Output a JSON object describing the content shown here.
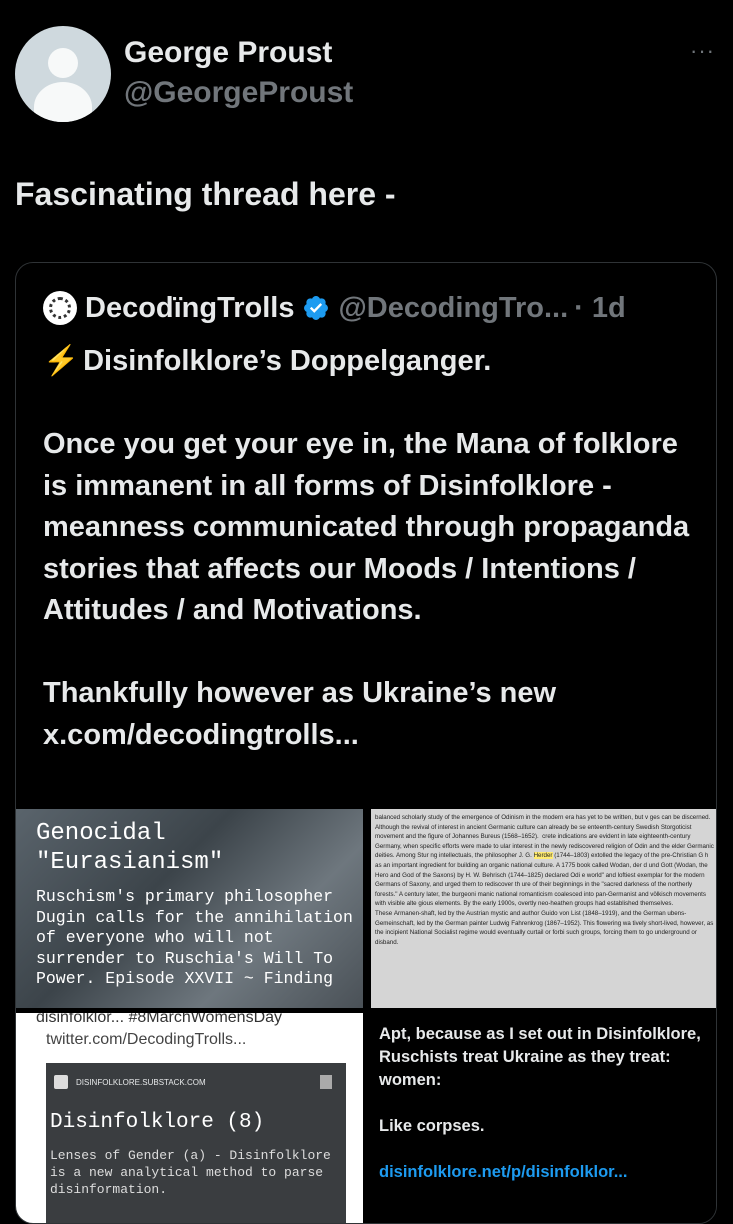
{
  "author": {
    "name": "George Proust",
    "handle": "@GeorgeProust"
  },
  "tweet": {
    "text": "Fascinating thread here -",
    "more_label": "···"
  },
  "quote": {
    "name": "DecodïngTrolls",
    "handle": "@DecodingTro...",
    "time": "· 1d",
    "title": "Disinfolklore’s Doppelganger.",
    "para1": "Once you get your eye in, the Mana of folklore is immanent in all forms of Disinfolklore - meanness communicated through propaganda stories that affects our Moods / Intentions / Attitudes / and Motivations.",
    "para2": "Thankfully however as Ukraine’s new",
    "link": "x.com/decodingtrolls..."
  },
  "media": {
    "img1_title": "Genocidal\n\"Eurasianism\"",
    "img1_text": "Ruschism's primary philosopher Dugin calls for the annihilation of everyone who will not surrender to Ruschia's Will To Power. Episode XXVII ~ Finding",
    "img2_text_a": "balanced scholarly study of the emergence of Odinism in the modern era has yet to be written, but v ges can be discerned. Although the revival of interest in ancient Germanic culture can already be se enteenth-century Swedish Storgoticist movement and the figure of Johannes Bureus (1568–1652).  crete indications are evident in late eighteenth-century Germany, when specific efforts were made to ular interest in the newly rediscovered religion of Odin and the elder Germanic deities. Among Stur ng intellectuals, the philosopher J. G.",
    "img2_highlight": "Herder",
    "img2_text_b": "(1744–1803) extolled the legacy of the pre-Christian G h as an important ingredient for building an organic national culture. A 1775 book called Wodan, der d und Gott (Wodan, the Hero and God of the Saxons) by H. W. Behrisch (1744–1825) declared Odi e world\" and loftiest exemplar for the modern Germans of Saxony, and urged them to rediscover th ure of their beginnings in the \"sacred darkness of the northerly forests.\" A century later, the burgeoni manic national romanticism coalesced into pan-Germanist and völkisch movements with visible alte gious elements. By the early 1900s, overtly neo-heathen groups had established themselves. These Armanen-shaft, led by the Austrian mystic and author Guido von List (1848–1919), and the German ubens-Gemeinschaft, led by the German painter Ludwig Fahrenkrog (1867–1952). This flowering wa tively short-lived, however, as the incipient National Socialist regime would eventually curtail or forbi such groups, forcing them to go underground or disband.",
    "img3_top": "disinfolklor... #8MarchWomensDay",
    "img3_url": "twitter.com/DecodingTrolls...",
    "img3_site": "DISINFOLKLORE.SUBSTACK.COM",
    "img3_title": "Disinfolklore (8)",
    "img3_desc": "Lenses of Gender (a) - Disinfolklore is a new analytical method to parse disinformation.",
    "img4_text1": "Apt, because as I set out in Disinfolklore, Ruschists treat Ukraine as they treat: women:",
    "img4_text2": "Like corpses.",
    "img4_link": "disinfolklore.net/p/disinfolklor..."
  },
  "colors": {
    "accent": "#1d9bf0",
    "muted": "#71767b",
    "text": "#e7e9ea",
    "border": "#2f3336"
  }
}
